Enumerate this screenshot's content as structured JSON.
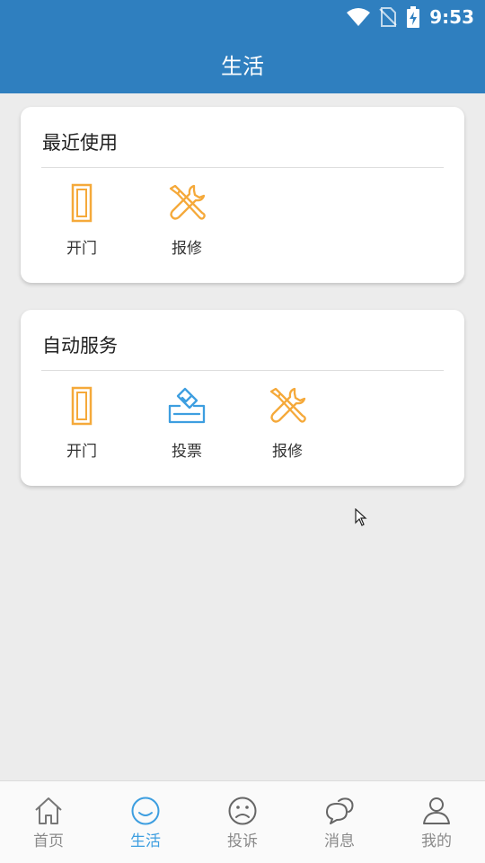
{
  "status_bar": {
    "time": "9:53"
  },
  "header": {
    "title": "生活"
  },
  "recent": {
    "title": "最近使用",
    "items": [
      {
        "label": "开门",
        "icon": "door-icon"
      },
      {
        "label": "报修",
        "icon": "repair-tools-icon"
      }
    ]
  },
  "services": {
    "title": "自动服务",
    "items": [
      {
        "label": "开门",
        "icon": "door-icon"
      },
      {
        "label": "投票",
        "icon": "vote-box-icon"
      },
      {
        "label": "报修",
        "icon": "repair-tools-icon"
      }
    ]
  },
  "tabs": [
    {
      "label": "首页",
      "icon": "home-icon"
    },
    {
      "label": "生活",
      "icon": "smile-icon",
      "active": true
    },
    {
      "label": "投诉",
      "icon": "frown-icon"
    },
    {
      "label": "消息",
      "icon": "chat-bubbles-icon"
    },
    {
      "label": "我的",
      "icon": "person-icon"
    }
  ],
  "colors": {
    "primary": "#2f7fbf",
    "accent": "#3d9ee0",
    "icon_orange": "#f5a93a",
    "background": "#ececec"
  }
}
